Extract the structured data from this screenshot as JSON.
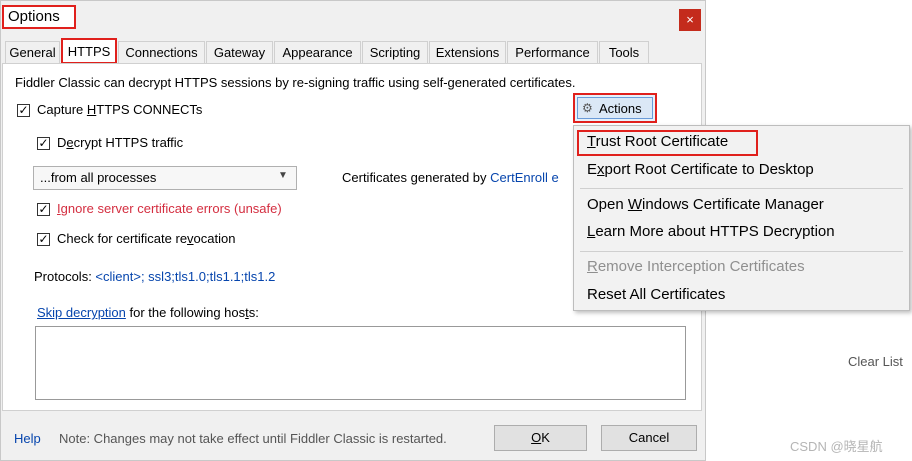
{
  "dialog": {
    "title": "Options",
    "close_glyph": "×",
    "tabs": [
      {
        "label": "General"
      },
      {
        "label": "HTTPS"
      },
      {
        "label": "Connections"
      },
      {
        "label": "Gateway"
      },
      {
        "label": "Appearance"
      },
      {
        "label": "Scripting"
      },
      {
        "label": "Extensions"
      },
      {
        "label": "Performance"
      },
      {
        "label": "Tools"
      }
    ],
    "active_tab": "HTTPS"
  },
  "https": {
    "intro": "Fiddler Classic can decrypt HTTPS sessions by re-signing traffic using self-generated certificates.",
    "capture_connects": {
      "pre": "Capture ",
      "u": "H",
      "post": "TTPS CONNECTs",
      "checked": true
    },
    "decrypt_traffic": {
      "pre": "D",
      "u": "e",
      "post": "crypt HTTPS traffic",
      "checked": true
    },
    "process_filter": "...from all processes",
    "certs_generated_by": "Certificates generated by ",
    "cert_engine_link": "CertEnroll e",
    "ignore_errors": {
      "u": "I",
      "post": "gnore server certificate errors (unsafe)",
      "checked": true
    },
    "check_revocation": {
      "pre": "Check for certificate re",
      "u": "v",
      "post": "ocation",
      "checked": true
    },
    "protocols_label": "Protocols: ",
    "protocols_value": "<client>; ssl3;tls1.0;tls1.1;tls1.2",
    "skip_link": "Skip decryption",
    "skip_rest": {
      "pre": " for the following hos",
      "u": "t",
      "post": "s:"
    },
    "hosts_value": ""
  },
  "actions": {
    "icon": "actions-icon",
    "label": "Actions",
    "menu": [
      {
        "u": "T",
        "post": "rust Root Certificate",
        "enabled": true
      },
      {
        "pre": "E",
        "u": "x",
        "post": "port Root Certificate to Desktop",
        "enabled": true
      },
      {
        "pre": "Open ",
        "u": "W",
        "post": "indows Certificate Manager",
        "enabled": true
      },
      {
        "u": "L",
        "post": "earn More about HTTPS Decryption",
        "enabled": true
      },
      {
        "u": "R",
        "post": "emove Interception Certificates",
        "enabled": false
      },
      {
        "pre": "Reset All Certificates",
        "enabled": true
      }
    ]
  },
  "footer": {
    "help": "Help",
    "note": "Note: Changes may not take effect until Fiddler Classic is restarted.",
    "ok_u": "O",
    "ok_post": "K",
    "cancel": "Cancel"
  },
  "background": {
    "clear_list": "Clear List",
    "watermark": "CSDN @晓星航"
  },
  "colors": {
    "highlight_border": "#e0201c",
    "link": "#0645ad",
    "warning_text": "#d42e40"
  }
}
